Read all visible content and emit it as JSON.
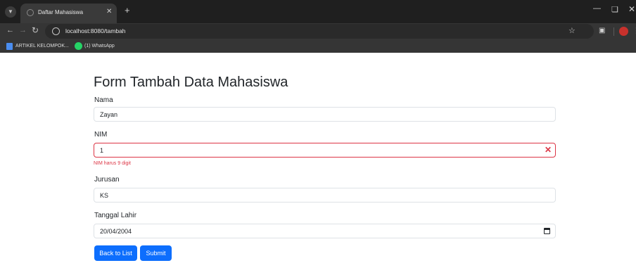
{
  "browser": {
    "tab_title": "Daftar Mahasiswa",
    "url": "localhost:8080/tambah",
    "bookmarks": [
      {
        "label": "ARTIKEL KELOMPOK...",
        "icon": "docs-icon"
      },
      {
        "label": "(1) WhatsApp",
        "icon": "whatsapp-icon"
      }
    ]
  },
  "form": {
    "title": "Form Tambah Data Mahasiswa",
    "fields": {
      "nama": {
        "label": "Nama",
        "value": "Zayan"
      },
      "nim": {
        "label": "NIM",
        "value": "1",
        "error": "NIM harus 9 digit"
      },
      "jurusan": {
        "label": "Jurusan",
        "value": "KS"
      },
      "tanggal_lahir": {
        "label": "Tanggal Lahir",
        "value": "20/04/2004"
      }
    },
    "buttons": {
      "back": "Back to List",
      "submit": "Submit"
    }
  },
  "colors": {
    "primary": "#0d6efd",
    "danger": "#dc3545",
    "chrome_dark": "#1f1f1f",
    "toolbar": "#353535"
  }
}
